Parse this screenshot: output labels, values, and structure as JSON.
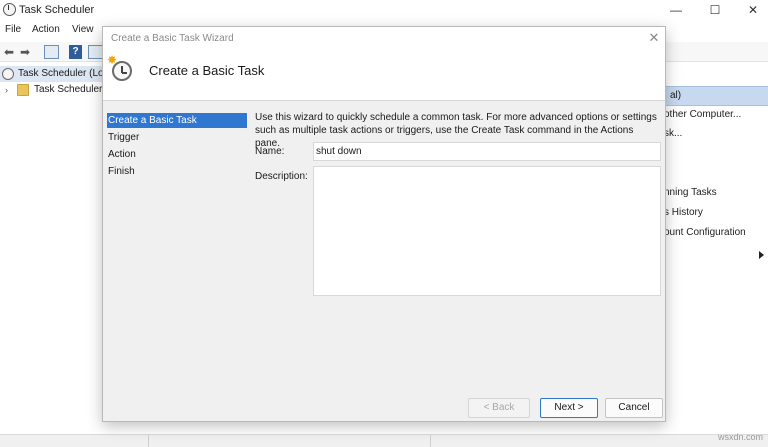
{
  "main_window": {
    "title": "Task Scheduler",
    "menu": [
      "File",
      "Action",
      "View"
    ],
    "controls": {
      "minimize": "—",
      "maximize": "☐",
      "close": "✕"
    }
  },
  "tree": {
    "root": "Task Scheduler (Local)",
    "child": "Task Scheduler Library"
  },
  "actions_pane": {
    "header": "al)",
    "items": [
      "other Computer...",
      "sk...",
      "nning Tasks",
      "s History",
      "ount Configuration"
    ]
  },
  "wizard": {
    "window_title": "Create a Basic Task Wizard",
    "header_title": "Create a Basic Task",
    "steps": [
      "Create a Basic Task",
      "Trigger",
      "Action",
      "Finish"
    ],
    "selected_step": 0,
    "description": "Use this wizard to quickly schedule a common task.  For more advanced options or settings such as multiple task actions or triggers, use the Create Task command in the Actions pane.",
    "name_label": "Name:",
    "name_value": "shut down",
    "description_label": "Description:",
    "description_value": "",
    "buttons": {
      "back": "< Back",
      "next": "Next >",
      "cancel": "Cancel"
    }
  },
  "watermark": "wsxdn.com",
  "colors": {
    "selection": "#2f77cf",
    "actions_header": "#c7d9ee"
  }
}
